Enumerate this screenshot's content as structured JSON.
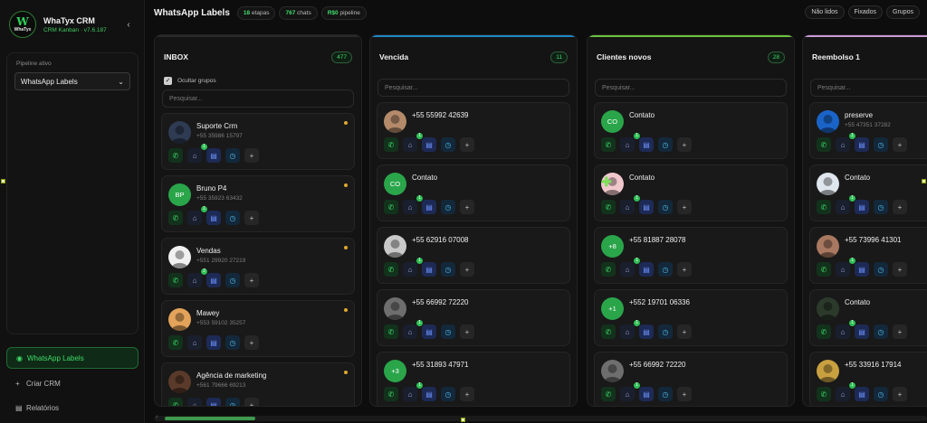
{
  "app": {
    "name": "WhaTyx CRM",
    "subtitle": "CRM Kanban · v7.6.187",
    "logo_top": "W",
    "logo_bottom": "WhaTyx"
  },
  "sidebar": {
    "pipeline_label": "Pipeline ativo",
    "pipeline_selected": "WhatsApp Labels",
    "nav": [
      {
        "label": "WhatsApp Labels",
        "active": true,
        "icon": "dot-icon"
      },
      {
        "label": "Criar CRM",
        "active": false,
        "icon": "plus-icon"
      },
      {
        "label": "Relatórios",
        "active": false,
        "icon": "report-icon"
      }
    ]
  },
  "header": {
    "title": "WhatsApp Labels",
    "stats": [
      {
        "value": "18",
        "unit": "etapas"
      },
      {
        "value": "767",
        "unit": "chats"
      },
      {
        "value": "R$0",
        "unit": "pipeline"
      }
    ],
    "filters": [
      "Não lidos",
      "Fixados",
      "Grupos"
    ]
  },
  "columns": [
    {
      "title": "INBOX",
      "count": "477",
      "accent": "#2a2a2a",
      "hide_groups_label": "Ocultar grupos",
      "search_placeholder": "Pesquisar...",
      "cards": [
        {
          "name": "Suporte Crm",
          "phone": "+55 35986 15797",
          "avatar": "img",
          "avatar_color": "#2f3b52",
          "initials": "",
          "dot": true,
          "badge": "1"
        },
        {
          "name": "Bruno P4",
          "phone": "+55 35923 63432",
          "avatar": "initials",
          "avatar_color": "#2aa54a",
          "initials": "BP",
          "dot": true,
          "badge": "1"
        },
        {
          "name": "Vendas",
          "phone": "+551 29920 27219",
          "avatar": "img",
          "avatar_color": "#f1f1f1",
          "initials": "",
          "dot": true,
          "badge": "2"
        },
        {
          "name": "Mawey",
          "phone": "+553 59102 35257",
          "avatar": "img",
          "avatar_color": "#e3a35a",
          "initials": "",
          "dot": true,
          "badge": ""
        },
        {
          "name": "Agência de marketing",
          "phone": "+561 79666 69213",
          "avatar": "img",
          "avatar_color": "#5a3a2a",
          "initials": "",
          "dot": true,
          "badge": ""
        }
      ]
    },
    {
      "title": "Vencida",
      "count": "11",
      "accent": "#1e86c8",
      "search_placeholder": "Pesquisar...",
      "cards": [
        {
          "name": "+55 55992 42639",
          "phone": "",
          "avatar": "img",
          "avatar_color": "#b48a6a",
          "initials": "",
          "dot": false,
          "badge": "1"
        },
        {
          "name": "Contato",
          "phone": "",
          "avatar": "initials",
          "avatar_color": "#2aa54a",
          "initials": "CO",
          "dot": false,
          "badge": "1"
        },
        {
          "name": "+55 62916 07008",
          "phone": "",
          "avatar": "img",
          "avatar_color": "#c9c9c9",
          "initials": "",
          "dot": false,
          "badge": "1"
        },
        {
          "name": "+55 66992 72220",
          "phone": "",
          "avatar": "img",
          "avatar_color": "#6e6e6e",
          "initials": "",
          "dot": false,
          "badge": "1"
        },
        {
          "name": "+55 31893 47971",
          "phone": "",
          "avatar": "initials",
          "avatar_color": "#2aa54a",
          "initials": "+3",
          "dot": false,
          "badge": "1"
        }
      ]
    },
    {
      "title": "Clientes novos",
      "count": "28",
      "accent": "#6bc23f",
      "search_placeholder": "Pesquisar...",
      "cards": [
        {
          "name": "Contato",
          "phone": "",
          "avatar": "initials",
          "avatar_color": "#2aa54a",
          "initials": "CO",
          "dot": false,
          "badge": "1"
        },
        {
          "name": "Contato",
          "phone": "",
          "avatar": "img",
          "avatar_color": "#f0c8cc",
          "initials": "",
          "dot": false,
          "badge": "1"
        },
        {
          "name": "+55 81887 28078",
          "phone": "",
          "avatar": "initials",
          "avatar_color": "#2aa54a",
          "initials": "+8",
          "dot": false,
          "badge": "1"
        },
        {
          "name": "+552 19701 06336",
          "phone": "",
          "avatar": "initials",
          "avatar_color": "#2aa54a",
          "initials": "+1",
          "dot": false,
          "badge": "1"
        },
        {
          "name": "+55 66992 72220",
          "phone": "",
          "avatar": "img",
          "avatar_color": "#6e6e6e",
          "initials": "",
          "dot": false,
          "badge": "1"
        }
      ]
    },
    {
      "title": "Reembolso 1",
      "count": "",
      "accent": "#c99ad6",
      "search_placeholder": "Pesquisar...",
      "cards": [
        {
          "name": "preserve",
          "phone": "+55 47351 37282",
          "avatar": "img",
          "avatar_color": "#1a64c8",
          "initials": "",
          "dot": false,
          "badge": "1"
        },
        {
          "name": "Contato",
          "phone": "",
          "avatar": "img",
          "avatar_color": "#dfe6ee",
          "initials": "",
          "dot": false,
          "badge": "1"
        },
        {
          "name": "+55 73996 41301",
          "phone": "",
          "avatar": "img",
          "avatar_color": "#a87860",
          "initials": "",
          "dot": false,
          "badge": "1"
        },
        {
          "name": "Contato",
          "phone": "",
          "avatar": "img",
          "avatar_color": "#2c3a2c",
          "initials": "",
          "dot": false,
          "badge": "1"
        },
        {
          "name": "+55 33916 17914",
          "phone": "",
          "avatar": "img",
          "avatar_color": "#c8a040",
          "initials": "",
          "dot": false,
          "badge": "1"
        }
      ]
    }
  ]
}
